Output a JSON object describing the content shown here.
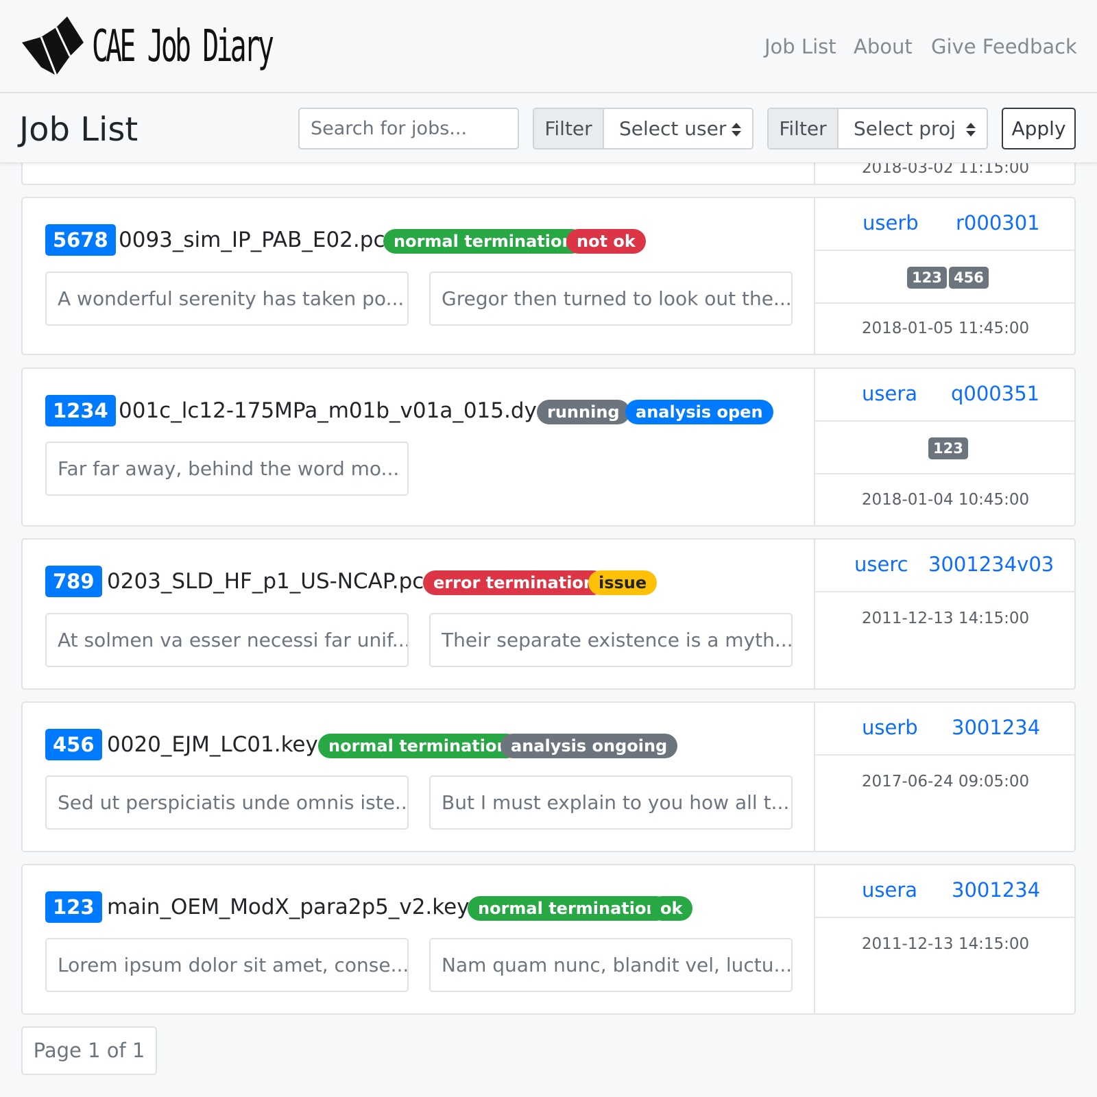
{
  "app": {
    "brand": "CAE Job Diary",
    "nav": [
      "Job List",
      "About",
      "Give Feedback"
    ]
  },
  "toolbar": {
    "title": "Job List",
    "search_placeholder": "Search for jobs...",
    "filter_label": "Filter",
    "user_select": "Select user",
    "project_select": "Select proj",
    "apply_label": "Apply"
  },
  "partial_card": {
    "date": "2018-03-02 11:15:00"
  },
  "jobs": [
    {
      "id": "5678",
      "name": "0093_sim_IP_PAB_E02.pc",
      "status": "normal termination",
      "result": "not ok",
      "notes": [
        "A wonderful serenity has taken po...",
        "Gregor then turned to look out the..."
      ],
      "user": "userb",
      "project": "r000301",
      "tags": [
        "123",
        "456"
      ],
      "date": "2018-01-05 11:45:00"
    },
    {
      "id": "1234",
      "name": "001c_lc12-175MPa_m01b_v01a_015.dyn",
      "status": "running",
      "result": "analysis open",
      "notes": [
        "Far far away, behind the word mo..."
      ],
      "user": "usera",
      "project": "q000351",
      "tags": [
        "123"
      ],
      "date": "2018-01-04 10:45:00"
    },
    {
      "id": "789",
      "name": "0203_SLD_HF_p1_US-NCAP.pc",
      "status": "error termination",
      "result": "issue",
      "notes": [
        "At solmen va esser necessi far unif...",
        "Their separate existence is a myth...."
      ],
      "user": "userc",
      "project": "3001234v03",
      "tags": [],
      "date": "2011-12-13 14:15:00"
    },
    {
      "id": "456",
      "name": "0020_EJM_LC01.key",
      "status": "normal termination",
      "result": "analysis ongoing",
      "notes": [
        "Sed ut perspiciatis unde omnis iste...",
        "But I must explain to you how all t..."
      ],
      "user": "userb",
      "project": "3001234",
      "tags": [],
      "date": "2017-06-24 09:05:00"
    },
    {
      "id": "123",
      "name": "main_OEM_ModX_para2p5_v2.key",
      "status": "normal termination",
      "result": "ok",
      "notes": [
        "Lorem ipsum dolor sit amet, conse...",
        "Nam quam nunc, blandit vel, luctu..."
      ],
      "user": "usera",
      "project": "3001234",
      "tags": [],
      "date": "2011-12-13 14:15:00"
    }
  ],
  "pagination": {
    "label": "Page 1 of 1"
  },
  "colors": {
    "primary": "#007bff",
    "success": "#28a745",
    "danger": "#dc3545",
    "secondary": "#6c757d",
    "warning": "#ffc107"
  }
}
